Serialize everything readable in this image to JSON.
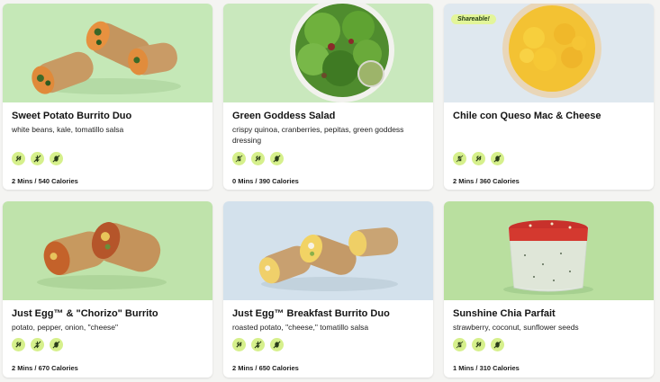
{
  "cards": [
    {
      "title": "Sweet Potato Burrito Duo",
      "description": "white beans, kale, tomatillo salsa",
      "meta": "2 Mins / 540 Calories",
      "diet_icons": [
        "plant-based-icon",
        "gluten-free-icon",
        "nut-free-icon"
      ],
      "photo_bg": "#c5e8b7"
    },
    {
      "title": "Green Goddess Salad",
      "description": "crispy quinoa, cranberries, pepitas, green goddess dressing",
      "meta": "0 Mins / 390 Calories",
      "diet_icons": [
        "dairy-free-icon",
        "plant-based-icon",
        "nut-free-icon"
      ],
      "photo_bg": "#c9e8bd"
    },
    {
      "title": "Chile con Queso Mac & Cheese",
      "description": "",
      "meta": "2 Mins / 360 Calories",
      "badge": "Shareable!",
      "diet_icons": [
        "dairy-free-icon",
        "plant-based-icon",
        "nut-free-icon"
      ],
      "photo_bg": "#dfe8ef"
    },
    {
      "title": "Just Egg™ & \"Chorizo\" Burrito",
      "description": "potato, pepper, onion, \"cheese\"",
      "meta": "2 Mins / 670 Calories",
      "diet_icons": [
        "plant-based-icon",
        "gluten-free-icon",
        "nut-free-icon"
      ],
      "photo_bg": "#bfe3ab"
    },
    {
      "title": "Just Egg™ Breakfast Burrito Duo",
      "description": "roasted potato, \"cheese,\" tomatillo salsa",
      "meta": "2 Mins / 650 Calories",
      "diet_icons": [
        "plant-based-icon",
        "gluten-free-icon",
        "nut-free-icon"
      ],
      "photo_bg": "#d3e1ec"
    },
    {
      "title": "Sunshine Chia Parfait",
      "description": "strawberry, coconut, sunflower seeds",
      "meta": "1 Mins / 310 Calories",
      "diet_icons": [
        "dairy-free-icon",
        "plant-based-icon",
        "nut-free-icon"
      ],
      "photo_bg": "#b9df9f"
    }
  ],
  "colors": {
    "badge_bg": "#e3f59a",
    "icon_bg": "#d6f08c",
    "icon_fg": "#2a3d1a"
  }
}
